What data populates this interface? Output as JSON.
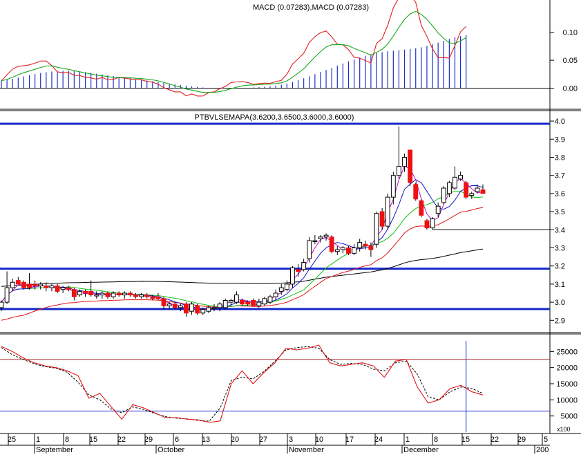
{
  "chart_data": {
    "type": "candlestick",
    "panels": {
      "macd": {
        "title": "MACD (0.07283),MACD (0.07283)",
        "ylim": [
          -0.035,
          0.155
        ],
        "yticks": [
          0.0,
          0.05,
          0.1
        ],
        "ytick_labels": [
          "0.00",
          "0.05",
          "0.10"
        ],
        "colors": {
          "bars": "#1a2fc8",
          "macd_line": "#e02020",
          "signal_line": "#17a817"
        }
      },
      "price": {
        "title": "PTBVLSEMAPA(3.6200,3.6500,3.6000,3.6000)",
        "ylim": [
          2.84,
          4.05
        ],
        "yticks": [
          2.9,
          3.0,
          3.1,
          3.2,
          3.3,
          3.4,
          3.5,
          3.6,
          3.7,
          3.8,
          3.9,
          4.0
        ],
        "ytick_labels": [
          "2.9",
          "3.0",
          "3.1",
          "3.2",
          "3.3",
          "3.4",
          "3.5",
          "3.6",
          "3.7",
          "3.8",
          "3.9",
          "4.0"
        ],
        "hlines": [
          {
            "value": 3.985,
            "color": "#1428c8",
            "width": "thick"
          },
          {
            "value": 3.185,
            "color": "#1428c8",
            "width": "thick"
          },
          {
            "value": 2.962,
            "color": "#1428c8",
            "width": "thick"
          }
        ],
        "support_segment": {
          "value": 3.4,
          "from_date": "Dec 7",
          "color": "#000000"
        },
        "colors": {
          "up": "#ffffff",
          "down": "#ee1111",
          "ma_blue": "#1414c8",
          "ma_green": "#10c010",
          "ma_magenta": "#c010c8",
          "ma_red": "#e01414",
          "ma_black": "#000000"
        }
      },
      "oscillator": {
        "ylim": [
          0,
          30000
        ],
        "yticks": [
          5000,
          10000,
          15000,
          20000,
          25000
        ],
        "ytick_labels": [
          "5000",
          "10000",
          "15000",
          "20000",
          "25000"
        ],
        "hlines": [
          {
            "value": 22500,
            "color": "#aa2222"
          },
          {
            "value": 6500,
            "color": "#1428c8"
          }
        ],
        "scale_label": "x100",
        "cursor_date": "Dec 15",
        "colors": {
          "main": "#e01414",
          "signal": "#000000",
          "cursor": "#1428c8"
        }
      }
    },
    "x_axis": {
      "day_labels": [
        "25",
        "1",
        "8",
        "15",
        "22",
        "29",
        "6",
        "13",
        "20",
        "27",
        "3",
        "10",
        "17",
        "24",
        "1",
        "8",
        "15",
        "22",
        "29",
        "5"
      ],
      "month_labels": [
        "September",
        "October",
        "November",
        "December",
        "200"
      ]
    },
    "ohlc": [
      {
        "d": "Aug 22",
        "o": 2.97,
        "h": 3.01,
        "l": 2.95,
        "c": 3.0
      },
      {
        "d": "Aug 23",
        "o": 3.0,
        "h": 3.17,
        "l": 2.99,
        "c": 3.08
      },
      {
        "d": "Aug 24",
        "o": 3.08,
        "h": 3.13,
        "l": 3.06,
        "c": 3.11
      },
      {
        "d": "Aug 25",
        "o": 3.12,
        "h": 3.14,
        "l": 3.1,
        "c": 3.1
      },
      {
        "d": "Aug 26",
        "o": 3.11,
        "h": 3.12,
        "l": 3.07,
        "c": 3.08
      },
      {
        "d": "Aug 29",
        "o": 3.1,
        "h": 3.16,
        "l": 3.07,
        "c": 3.08
      },
      {
        "d": "Aug 30",
        "o": 3.1,
        "h": 3.12,
        "l": 3.07,
        "c": 3.09
      },
      {
        "d": "Aug 31",
        "o": 3.09,
        "h": 3.11,
        "l": 3.07,
        "c": 3.1
      },
      {
        "d": "Sep 1",
        "o": 3.09,
        "h": 3.11,
        "l": 3.06,
        "c": 3.08
      },
      {
        "d": "Sep 2",
        "o": 3.08,
        "h": 3.1,
        "l": 3.06,
        "c": 3.09
      },
      {
        "d": "Sep 5",
        "o": 3.09,
        "h": 3.1,
        "l": 3.05,
        "c": 3.06
      },
      {
        "d": "Sep 6",
        "o": 3.07,
        "h": 3.09,
        "l": 3.05,
        "c": 3.08
      },
      {
        "d": "Sep 7",
        "o": 3.08,
        "h": 3.09,
        "l": 3.06,
        "c": 3.07
      },
      {
        "d": "Sep 8",
        "o": 3.07,
        "h": 3.08,
        "l": 3.01,
        "c": 3.03
      },
      {
        "d": "Sep 9",
        "o": 3.04,
        "h": 3.07,
        "l": 3.03,
        "c": 3.06
      },
      {
        "d": "Sep 12",
        "o": 3.06,
        "h": 3.07,
        "l": 3.03,
        "c": 3.05
      },
      {
        "d": "Sep 13",
        "o": 3.06,
        "h": 3.12,
        "l": 3.03,
        "c": 3.04
      },
      {
        "d": "Sep 14",
        "o": 3.04,
        "h": 3.06,
        "l": 3.02,
        "c": 3.04
      },
      {
        "d": "Sep 15",
        "o": 3.04,
        "h": 3.06,
        "l": 3.02,
        "c": 3.05
      },
      {
        "d": "Sep 16",
        "o": 3.05,
        "h": 3.06,
        "l": 3.02,
        "c": 3.03
      },
      {
        "d": "Sep 19",
        "o": 3.03,
        "h": 3.06,
        "l": 3.02,
        "c": 3.05
      },
      {
        "d": "Sep 20",
        "o": 3.05,
        "h": 3.06,
        "l": 3.03,
        "c": 3.04
      },
      {
        "d": "Sep 21",
        "o": 3.04,
        "h": 3.06,
        "l": 3.02,
        "c": 3.05
      },
      {
        "d": "Sep 22",
        "o": 3.05,
        "h": 3.06,
        "l": 3.03,
        "c": 3.04
      },
      {
        "d": "Sep 23",
        "o": 3.04,
        "h": 3.05,
        "l": 3.02,
        "c": 3.03
      },
      {
        "d": "Sep 26",
        "o": 3.03,
        "h": 3.05,
        "l": 3.02,
        "c": 3.04
      },
      {
        "d": "Sep 27",
        "o": 3.04,
        "h": 3.05,
        "l": 3.02,
        "c": 3.03
      },
      {
        "d": "Sep 28",
        "o": 3.03,
        "h": 3.04,
        "l": 3.01,
        "c": 3.02
      },
      {
        "d": "Sep 29",
        "o": 3.03,
        "h": 3.05,
        "l": 3.01,
        "c": 3.02
      },
      {
        "d": "Sep 30",
        "o": 3.02,
        "h": 3.03,
        "l": 2.96,
        "c": 2.98
      },
      {
        "d": "Oct 3",
        "o": 2.98,
        "h": 3.0,
        "l": 2.96,
        "c": 2.99
      },
      {
        "d": "Oct 4",
        "o": 2.99,
        "h": 3.0,
        "l": 2.96,
        "c": 2.97
      },
      {
        "d": "Oct 5",
        "o": 2.97,
        "h": 2.99,
        "l": 2.95,
        "c": 2.98
      },
      {
        "d": "Oct 6",
        "o": 2.99,
        "h": 3.0,
        "l": 2.92,
        "c": 2.94
      },
      {
        "d": "Oct 7",
        "o": 2.95,
        "h": 3.0,
        "l": 2.93,
        "c": 2.99
      },
      {
        "d": "Oct 10",
        "o": 2.98,
        "h": 2.99,
        "l": 2.93,
        "c": 2.94
      },
      {
        "d": "Oct 11",
        "o": 2.94,
        "h": 2.97,
        "l": 2.93,
        "c": 2.96
      },
      {
        "d": "Oct 12",
        "o": 2.95,
        "h": 2.98,
        "l": 2.94,
        "c": 2.97
      },
      {
        "d": "Oct 13",
        "o": 2.97,
        "h": 2.99,
        "l": 2.95,
        "c": 2.97
      },
      {
        "d": "Oct 14",
        "o": 2.97,
        "h": 3.0,
        "l": 2.95,
        "c": 2.99
      },
      {
        "d": "Oct 17",
        "o": 2.97,
        "h": 3.02,
        "l": 2.96,
        "c": 3.01
      },
      {
        "d": "Oct 18",
        "o": 3.0,
        "h": 3.02,
        "l": 2.98,
        "c": 3.01
      },
      {
        "d": "Oct 19",
        "o": 3.0,
        "h": 3.06,
        "l": 2.99,
        "c": 3.04
      },
      {
        "d": "Oct 20",
        "o": 3.01,
        "h": 3.02,
        "l": 2.98,
        "c": 2.99
      },
      {
        "d": "Oct 21",
        "o": 3.0,
        "h": 3.01,
        "l": 2.98,
        "c": 2.99
      },
      {
        "d": "Oct 24",
        "o": 3.01,
        "h": 3.02,
        "l": 2.98,
        "c": 2.98
      },
      {
        "d": "Oct 25",
        "o": 2.98,
        "h": 3.02,
        "l": 2.97,
        "c": 3.0
      },
      {
        "d": "Oct 26",
        "o": 2.99,
        "h": 3.03,
        "l": 2.98,
        "c": 3.02
      },
      {
        "d": "Oct 27",
        "o": 3.0,
        "h": 3.04,
        "l": 2.99,
        "c": 3.03
      },
      {
        "d": "Oct 28",
        "o": 3.03,
        "h": 3.07,
        "l": 3.01,
        "c": 3.05
      },
      {
        "d": "Oct 31",
        "o": 3.06,
        "h": 3.1,
        "l": 3.04,
        "c": 3.08
      },
      {
        "d": "Nov 1",
        "o": 3.07,
        "h": 3.12,
        "l": 3.06,
        "c": 3.1
      },
      {
        "d": "Nov 2",
        "o": 3.1,
        "h": 3.2,
        "l": 3.08,
        "c": 3.19
      },
      {
        "d": "Nov 3",
        "o": 3.18,
        "h": 3.21,
        "l": 3.14,
        "c": 3.17
      },
      {
        "d": "Nov 4",
        "o": 3.18,
        "h": 3.24,
        "l": 3.17,
        "c": 3.22
      },
      {
        "d": "Nov 7",
        "o": 3.24,
        "h": 3.36,
        "l": 3.22,
        "c": 3.34
      },
      {
        "d": "Nov 8",
        "o": 3.34,
        "h": 3.37,
        "l": 3.32,
        "c": 3.34
      },
      {
        "d": "Nov 9",
        "o": 3.35,
        "h": 3.37,
        "l": 3.33,
        "c": 3.36
      },
      {
        "d": "Nov 10",
        "o": 3.36,
        "h": 3.38,
        "l": 3.34,
        "c": 3.37
      },
      {
        "d": "Nov 11",
        "o": 3.36,
        "h": 3.37,
        "l": 3.27,
        "c": 3.28
      },
      {
        "d": "Nov 14",
        "o": 3.28,
        "h": 3.31,
        "l": 3.26,
        "c": 3.29
      },
      {
        "d": "Nov 15",
        "o": 3.29,
        "h": 3.31,
        "l": 3.27,
        "c": 3.3
      },
      {
        "d": "Nov 16",
        "o": 3.3,
        "h": 3.31,
        "l": 3.26,
        "c": 3.27
      },
      {
        "d": "Nov 17",
        "o": 3.27,
        "h": 3.32,
        "l": 3.26,
        "c": 3.3
      },
      {
        "d": "Nov 18",
        "o": 3.3,
        "h": 3.35,
        "l": 3.28,
        "c": 3.33
      },
      {
        "d": "Nov 21",
        "o": 3.32,
        "h": 3.34,
        "l": 3.29,
        "c": 3.31
      },
      {
        "d": "Nov 22",
        "o": 3.31,
        "h": 3.33,
        "l": 3.25,
        "c": 3.29
      },
      {
        "d": "Nov 23",
        "o": 3.32,
        "h": 3.5,
        "l": 3.3,
        "c": 3.49
      },
      {
        "d": "Nov 24",
        "o": 3.5,
        "h": 3.52,
        "l": 3.4,
        "c": 3.42
      },
      {
        "d": "Nov 25",
        "o": 3.42,
        "h": 3.6,
        "l": 3.4,
        "c": 3.58
      },
      {
        "d": "Nov 28",
        "o": 3.58,
        "h": 3.72,
        "l": 3.54,
        "c": 3.7
      },
      {
        "d": "Nov 29",
        "o": 3.7,
        "h": 3.97,
        "l": 3.68,
        "c": 3.75
      },
      {
        "d": "Nov 30",
        "o": 3.75,
        "h": 3.82,
        "l": 3.72,
        "c": 3.8
      },
      {
        "d": "Dec 1",
        "o": 3.84,
        "h": 3.84,
        "l": 3.64,
        "c": 3.66
      },
      {
        "d": "Dec 2",
        "o": 3.65,
        "h": 3.66,
        "l": 3.56,
        "c": 3.57
      },
      {
        "d": "Dec 5",
        "o": 3.56,
        "h": 3.57,
        "l": 3.47,
        "c": 3.48
      },
      {
        "d": "Dec 6",
        "o": 3.45,
        "h": 3.46,
        "l": 3.4,
        "c": 3.41
      },
      {
        "d": "Dec 7",
        "o": 3.41,
        "h": 3.47,
        "l": 3.4,
        "c": 3.46
      },
      {
        "d": "Dec 8",
        "o": 3.49,
        "h": 3.55,
        "l": 3.47,
        "c": 3.53
      },
      {
        "d": "Dec 9",
        "o": 3.55,
        "h": 3.64,
        "l": 3.54,
        "c": 3.63
      },
      {
        "d": "Dec 12",
        "o": 3.6,
        "h": 3.67,
        "l": 3.58,
        "c": 3.66
      },
      {
        "d": "Dec 13",
        "o": 3.63,
        "h": 3.75,
        "l": 3.62,
        "c": 3.69
      },
      {
        "d": "Dec 14",
        "o": 3.68,
        "h": 3.72,
        "l": 3.67,
        "c": 3.7
      },
      {
        "d": "Dec 15",
        "o": 3.66,
        "h": 3.67,
        "l": 3.57,
        "c": 3.58
      },
      {
        "d": "Dec 16",
        "o": 3.59,
        "h": 3.61,
        "l": 3.57,
        "c": 3.6
      },
      {
        "d": "Dec 19",
        "o": 3.61,
        "h": 3.65,
        "l": 3.6,
        "c": 3.63
      },
      {
        "d": "Dec 20",
        "o": 3.62,
        "h": 3.65,
        "l": 3.6,
        "c": 3.6
      }
    ],
    "macd_series": {
      "histogram": [
        0.0133,
        0.015,
        0.0169,
        0.019,
        0.0211,
        0.0233,
        0.0253,
        0.0272,
        0.0287,
        0.0299,
        0.0306,
        0.031,
        0.031,
        0.0306,
        0.0298,
        0.0287,
        0.0275,
        0.0261,
        0.0247,
        0.0232,
        0.0218,
        0.0204,
        0.019,
        0.0177,
        0.0164,
        0.0151,
        0.0138,
        0.0125,
        0.0112,
        0.0099,
        0.0085,
        0.0072,
        0.0059,
        0.0046,
        0.0034,
        0.0023,
        0.0014,
        0.0006,
        0.0,
        -0.0003,
        -0.0004,
        -0.0003,
        -0.0001,
        0.0003,
        0.0008,
        0.0014,
        0.002,
        0.0026,
        0.0034,
        0.0046,
        0.0063,
        0.0085,
        0.0112,
        0.0143,
        0.0177,
        0.0213,
        0.025,
        0.0288,
        0.0326,
        0.0364,
        0.0403,
        0.0441,
        0.0478,
        0.0514,
        0.0548,
        0.0579,
        0.0605,
        0.0627,
        0.0645,
        0.0659,
        0.067,
        0.068,
        0.0689,
        0.0699,
        0.0712,
        0.0731,
        0.0755,
        0.0783,
        0.0814,
        0.0847,
        0.0879,
        0.0908,
        0.0931,
        0.0945
      ],
      "note": "histogram sampled per bar; red and green lines drawn as smoothed curves"
    },
    "oscillator_series": {
      "main": [
        26500,
        25000,
        23000,
        21500,
        20500,
        20000,
        19000,
        17500,
        10500,
        12000,
        8000,
        4000,
        8500,
        7500,
        6000,
        4500,
        4500,
        4000,
        3800,
        3000,
        3500,
        15000,
        19000,
        15000,
        18500,
        21500,
        26000,
        25500,
        26000,
        27000,
        21500,
        20500,
        21000,
        21500,
        20500,
        17000,
        22000,
        22500,
        14000,
        9000,
        10000,
        13500,
        14500,
        12500,
        11500
      ],
      "signal": [
        26200,
        24000,
        22500,
        21200,
        20300,
        19800,
        18600,
        15500,
        11500,
        10000,
        7200,
        6000,
        7800,
        7000,
        5800,
        4800,
        4300,
        4100,
        3600,
        3400,
        7500,
        16000,
        17000,
        16500,
        18800,
        22000,
        25500,
        26200,
        26500,
        26000,
        22500,
        21000,
        21300,
        21000,
        19500,
        19000,
        21500,
        22000,
        18000,
        11000,
        10000,
        12500,
        14000,
        13500,
        12000
      ]
    }
  }
}
